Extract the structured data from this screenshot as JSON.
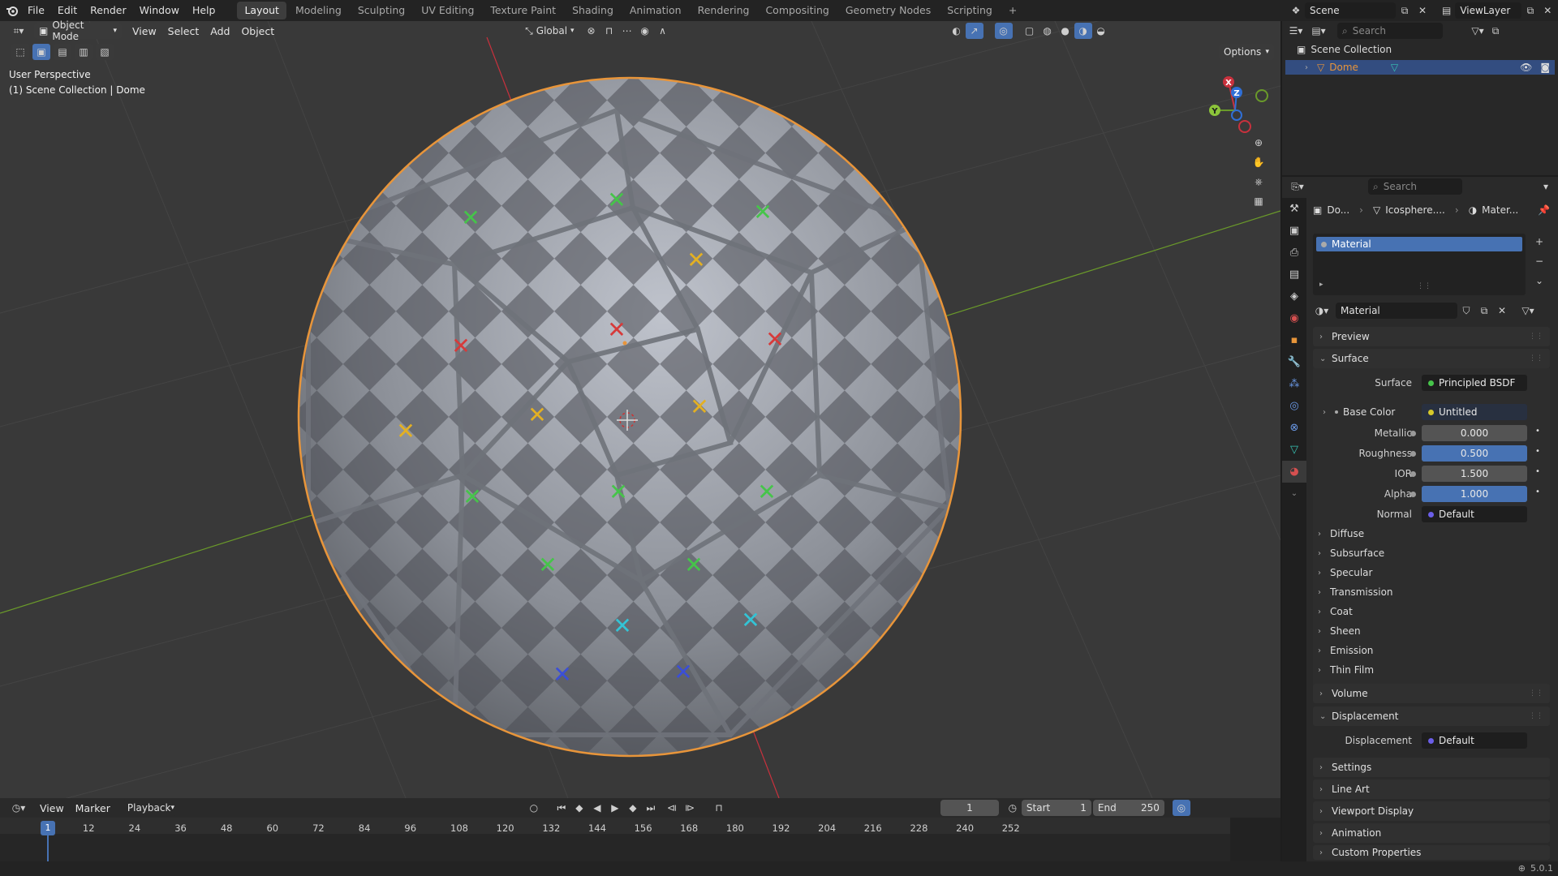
{
  "topbar": {
    "menus": [
      "File",
      "Edit",
      "Render",
      "Window",
      "Help"
    ],
    "workspaces": [
      "Layout",
      "Modeling",
      "Sculpting",
      "UV Editing",
      "Texture Paint",
      "Shading",
      "Animation",
      "Rendering",
      "Compositing",
      "Geometry Nodes",
      "Scripting"
    ],
    "active_workspace": "Layout",
    "add_tab": "+",
    "scene_name": "Scene",
    "view_layer": "ViewLayer"
  },
  "viewport": {
    "mode": "Object Mode",
    "menus": [
      "View",
      "Select",
      "Add",
      "Object"
    ],
    "orientation": "Global",
    "options_label": "Options",
    "overlay_title": "User Perspective",
    "overlay_subtitle": "(1) Scene Collection | Dome",
    "gizmo_labels": {
      "x": "X",
      "y": "Y",
      "z": "Z"
    }
  },
  "outliner": {
    "search_placeholder": "Search",
    "root": "Scene Collection",
    "item": "Dome"
  },
  "properties": {
    "search_placeholder": "Search",
    "breadcrumb": [
      "Do...",
      "Icosphere....",
      "Mater..."
    ],
    "slot_name": "Material",
    "material_name": "Material",
    "sections": {
      "preview": "Preview",
      "surface": "Surface",
      "volume": "Volume",
      "displacement": "Displacement",
      "settings": "Settings",
      "line_art": "Line Art",
      "viewport_display": "Viewport Display",
      "animation": "Animation",
      "custom_properties": "Custom Properties"
    },
    "surface_label": "Surface",
    "surface_value": "Principled BSDF",
    "base_color_label": "Base Color",
    "base_color_value": "Untitled",
    "params": [
      {
        "label": "Metallic",
        "value": "0.000",
        "fill": 0.0
      },
      {
        "label": "Roughness",
        "value": "0.500",
        "fill": 0.5
      },
      {
        "label": "IOR",
        "value": "1.500",
        "fill": 0.0
      },
      {
        "label": "Alpha",
        "value": "1.000",
        "fill": 1.0
      }
    ],
    "normal_label": "Normal",
    "normal_value": "Default",
    "subsections": [
      "Diffuse",
      "Subsurface",
      "Specular",
      "Transmission",
      "Coat",
      "Sheen",
      "Emission",
      "Thin Film"
    ],
    "displacement_label": "Displacement",
    "displacement_value": "Default"
  },
  "timeline": {
    "menus": [
      "View",
      "Marker",
      "Playback"
    ],
    "current_frame": "1",
    "start_label": "Start",
    "start_value": "1",
    "end_label": "End",
    "end_value": "250",
    "ticks": [
      "1",
      "12",
      "24",
      "36",
      "48",
      "60",
      "72",
      "84",
      "96",
      "108",
      "120",
      "132",
      "144",
      "156",
      "168",
      "180",
      "192",
      "204",
      "216",
      "228",
      "240",
      "252"
    ]
  },
  "statusbar": {
    "version": "5.0.1"
  },
  "colors": {
    "accent": "#4772b3",
    "selection_outline": "#e8953a",
    "x_axis": "#c8313d",
    "y_axis": "#6a9a2a",
    "z_axis": "#2f6fd6"
  }
}
